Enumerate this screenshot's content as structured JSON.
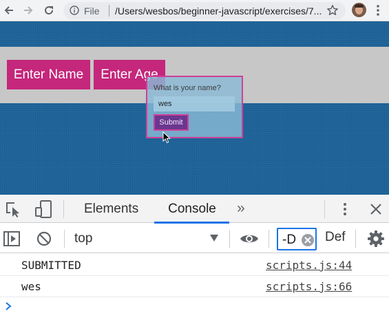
{
  "browser": {
    "scheme_label": "File",
    "url": "/Users/wesbos/beginner-javascript/exercises/7...",
    "icons": [
      "arrow-left-icon",
      "arrow-right-icon",
      "reload-icon",
      "info-icon",
      "star-icon",
      "avatar",
      "kebab-menu-icon"
    ]
  },
  "page": {
    "buttons": [
      "Enter Name",
      "Enter Age"
    ],
    "dialog": {
      "label": "What is your name?",
      "input_value": "wes",
      "submit_label": "Submit"
    },
    "colors": {
      "background": "#1e6399",
      "band": "#c7c7c7",
      "button": "#c4277b",
      "submit": "#6a3790"
    }
  },
  "devtools": {
    "tabs": [
      "Elements",
      "Console"
    ],
    "active_tab": "Console",
    "more_tabs_label": "»",
    "console_toolbar": {
      "context": "top",
      "filter_value": "-D",
      "levels_label": "Def"
    },
    "logs": [
      {
        "message": "SUBMITTED",
        "source": "scripts.js:44"
      },
      {
        "message": "wes",
        "source": "scripts.js:66"
      }
    ],
    "accent_color": "#1a73e8"
  }
}
